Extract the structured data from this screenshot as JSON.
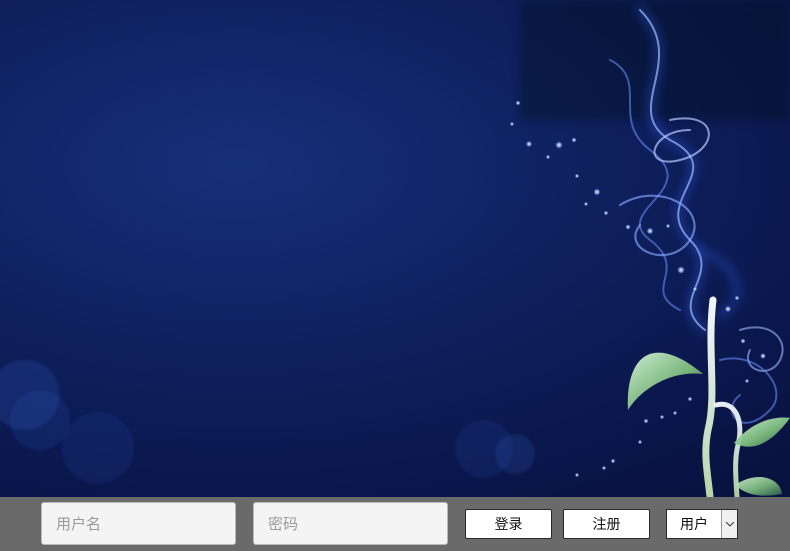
{
  "login_form": {
    "username": {
      "placeholder": "用户名",
      "value": ""
    },
    "password": {
      "placeholder": "密码",
      "value": ""
    },
    "login_label": "登录",
    "register_label": "注册",
    "role_select": {
      "selected": "用户",
      "icon": "chevron-down-icon"
    }
  },
  "colors": {
    "bar_background": "#6a6a6a",
    "background_deep_blue": "#0f2160"
  },
  "background": {
    "icon": "glowing-plant-illustration"
  }
}
